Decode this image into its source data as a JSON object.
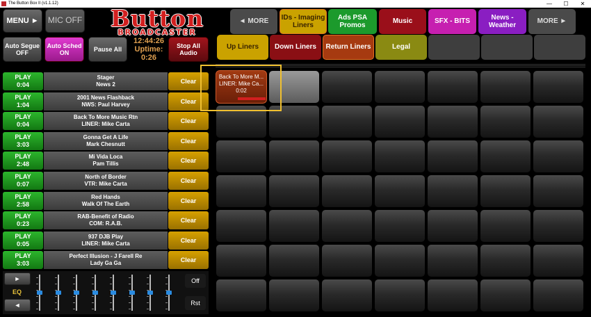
{
  "window": {
    "title": "The Button Box II (v1.1.12)",
    "minimize": "—",
    "maximize": "☐",
    "close": "✕"
  },
  "header": {
    "menu_label": "MENU ►",
    "mic_label": "MIC OFF",
    "logo_line1": "Button",
    "logo_line2": "BROADCASTER"
  },
  "controls": {
    "auto_segue": "Auto Segue OFF",
    "auto_sched": "Auto Sched ON",
    "pause_all": "Pause All",
    "stop_all": "Stop All Audio",
    "clock_time": "12:44:26",
    "uptime_label": "Uptime:",
    "uptime_value": "0:26"
  },
  "category_tabs": [
    {
      "label": "◄ MORE",
      "color": "#4a4a4a",
      "text_color": "#dddddd"
    },
    {
      "label": "IDs - Imaging Liners",
      "color": "#caa200",
      "text_color": "#3a2400"
    },
    {
      "label": "Ads  PSA Promos",
      "color": "#1c9a2c",
      "text_color": "#ffffff"
    },
    {
      "label": "Music",
      "color": "#9a0f1a",
      "text_color": "#ffffff"
    },
    {
      "label": "SFX - BITS",
      "color": "#c61fb0",
      "text_color": "#ffffff"
    },
    {
      "label": "News - Weather",
      "color": "#8a1ec2",
      "text_color": "#ffffff"
    },
    {
      "label": "MORE ►",
      "color": "#4a4a4a",
      "text_color": "#dddddd"
    }
  ],
  "sub_tabs": [
    {
      "label": "Up Liners",
      "color": "#caa200",
      "text_color": "#3a2400"
    },
    {
      "label": "Down Liners",
      "color": "#8a0f14",
      "text_color": "#ffffff"
    },
    {
      "label": "Return Liners",
      "color": "#a63a10",
      "text_color": "#ffffff"
    },
    {
      "label": "Legal",
      "color": "#8a8a12",
      "text_color": "#ffffff"
    },
    {
      "label": "",
      "color": "#3e3e3e",
      "text_color": "#ffffff"
    },
    {
      "label": "",
      "color": "#3e3e3e",
      "text_color": "#ffffff"
    },
    {
      "label": "",
      "color": "#3e3e3e",
      "text_color": "#ffffff"
    }
  ],
  "carts": [
    {
      "play": "PLAY",
      "time": "0:04",
      "line1": "Stager",
      "line2": "News 2",
      "clear": "Clear"
    },
    {
      "play": "PLAY",
      "time": "1:04",
      "line1": "2001 News Flashback",
      "line2": "NWS:  Paul Harvey",
      "clear": "Clear"
    },
    {
      "play": "PLAY",
      "time": "0:04",
      "line1": "Back To More Music Rtn",
      "line2": "LINER: Mike Carta",
      "clear": "Clear"
    },
    {
      "play": "PLAY",
      "time": "3:03",
      "line1": "Gonna Get A Life",
      "line2": "Mark Chesnutt",
      "clear": "Clear"
    },
    {
      "play": "PLAY",
      "time": "2:48",
      "line1": "Mi Vida Loca",
      "line2": "Pam Tillis",
      "clear": "Clear"
    },
    {
      "play": "PLAY",
      "time": "0:07",
      "line1": "North of Border",
      "line2": "VTR: Mike Carta",
      "clear": "Clear"
    },
    {
      "play": "PLAY",
      "time": "2:58",
      "line1": "Red Hands",
      "line2": "Walk Of The Earth",
      "clear": "Clear"
    },
    {
      "play": "PLAY",
      "time": "0:23",
      "line1": "RAB-Benefit of Radio",
      "line2": "COM: R.A.B.",
      "clear": "Clear"
    },
    {
      "play": "PLAY",
      "time": "0:05",
      "line1": "937 DJB Play",
      "line2": "LINER: Mike Carta",
      "clear": "Clear"
    },
    {
      "play": "PLAY",
      "time": "3:03",
      "line1": "Perfect Illusion - J Farell Re",
      "line2": "Lady Ga Ga",
      "clear": "Clear"
    }
  ],
  "eq": {
    "next": "►",
    "label": "EQ",
    "prev": "◄",
    "off": "Off",
    "reset": "Rst",
    "levels": [
      0.5,
      0.5,
      0.5,
      0.5,
      0.5,
      0.5,
      0.5,
      0.5
    ]
  },
  "active_cart": {
    "line1": "Back To More M...",
    "line2": "LINER: Mike Ca...",
    "time": "0:02"
  }
}
